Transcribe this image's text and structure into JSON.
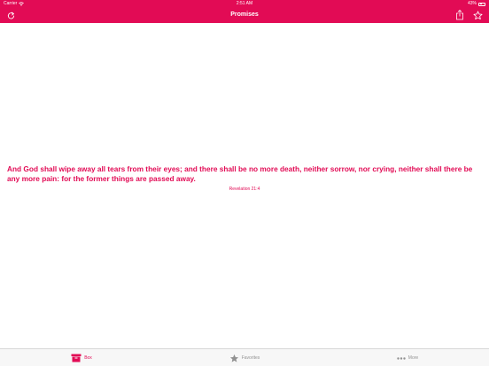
{
  "status_bar": {
    "carrier": "Carrier",
    "time": "2:51 AM",
    "battery_text": "43%",
    "battery_level": 0.43
  },
  "nav": {
    "title": "Promises",
    "left_icon": "refresh-icon",
    "right_icons": [
      "share-icon",
      "star-outline-icon"
    ]
  },
  "verse": {
    "text": "And God shall wipe away all tears from their eyes; and there shall be no more death, neither sorrow, nor crying, neither shall there be any more pain: for the former things are passed away.",
    "reference": "Revelation 21:4"
  },
  "tabs": [
    {
      "label": "Box",
      "icon": "box-icon",
      "selected": true
    },
    {
      "label": "Favorites",
      "icon": "star-icon",
      "selected": false
    },
    {
      "label": "More",
      "icon": "more-dots-icon",
      "selected": false
    }
  ],
  "colors": {
    "accent": "#e20b55",
    "tab_inactive": "#929292",
    "tab_bar_bg": "#f7f7f7"
  }
}
